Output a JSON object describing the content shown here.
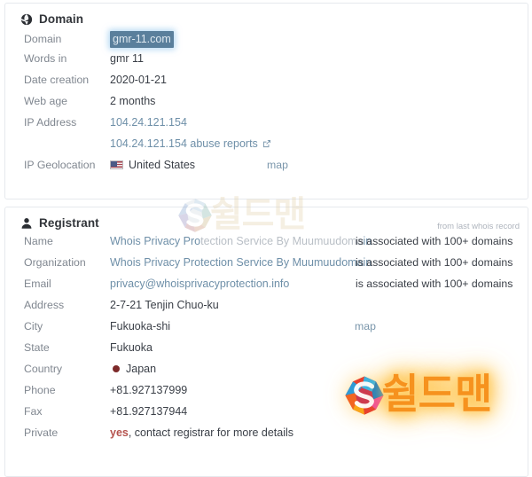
{
  "domain_card": {
    "icon": "globe-icon",
    "title": "Domain",
    "rows": [
      {
        "label": "Domain",
        "value": "gmr-11.com",
        "style": "selected"
      },
      {
        "label": "Words in",
        "value": "gmr 11",
        "style": "plain"
      },
      {
        "label": "Date creation",
        "value": "2020-01-21",
        "style": "plain"
      },
      {
        "label": "Web age",
        "value": "2 months",
        "style": "plain"
      },
      {
        "label": "IP Address",
        "value": "104.24.121.154",
        "style": "link"
      },
      {
        "label": "",
        "value": "104.24.121.154 abuse reports",
        "style": "link-external",
        "icon": "external-link-icon"
      },
      {
        "label": "IP Geolocation",
        "value": "United States",
        "style": "flag",
        "flag": "us-flag-icon",
        "map_label": "map"
      }
    ]
  },
  "registrant_card": {
    "icon": "user-icon",
    "title": "Registrant",
    "note": "from last whois record",
    "rows": [
      {
        "label": "Name",
        "value": "Whois Privacy Protection Service By Muumuudomain",
        "style": "link-faded",
        "assoc": "is associated with 100+ domains"
      },
      {
        "label": "Organization",
        "value": "Whois Privacy Protection Service By Muumuudomain",
        "style": "link",
        "assoc": "is associated with 100+ domains"
      },
      {
        "label": "Email",
        "value": "privacy@whoisprivacyprotection.info",
        "style": "link",
        "assoc": "is associated with 100+ domains"
      },
      {
        "label": "Address",
        "value": "2-7-21 Tenjin Chuo-ku",
        "style": "plain"
      },
      {
        "label": "City",
        "value": "Fukuoka-shi",
        "style": "plain",
        "map_label": "map"
      },
      {
        "label": "State",
        "value": "Fukuoka",
        "style": "plain"
      },
      {
        "label": "Country",
        "value": "Japan",
        "style": "flag",
        "flag": "jp-flag-icon"
      },
      {
        "label": "Phone",
        "value": "+81.927137999",
        "style": "plain"
      },
      {
        "label": "Fax",
        "value": "+81.927137944",
        "style": "plain"
      },
      {
        "label": "Private",
        "value": "yes",
        "value_suffix": ", contact registrar for more details",
        "style": "emphasis"
      }
    ]
  },
  "watermarks": {
    "top": {
      "logo": "shieldman-s-logo",
      "text": "쉴드맨"
    },
    "bottom": {
      "logo": "shieldman-s-logo",
      "text": "쉴드맨"
    }
  },
  "colors": {
    "link": "#6e8fa8",
    "label": "#808790",
    "value": "#3a3f47",
    "selection_bg": "#5a7f9c",
    "emphasis": "#b5534e",
    "watermark_orange": "#f6921e",
    "card_border": "#e6e9ed"
  }
}
